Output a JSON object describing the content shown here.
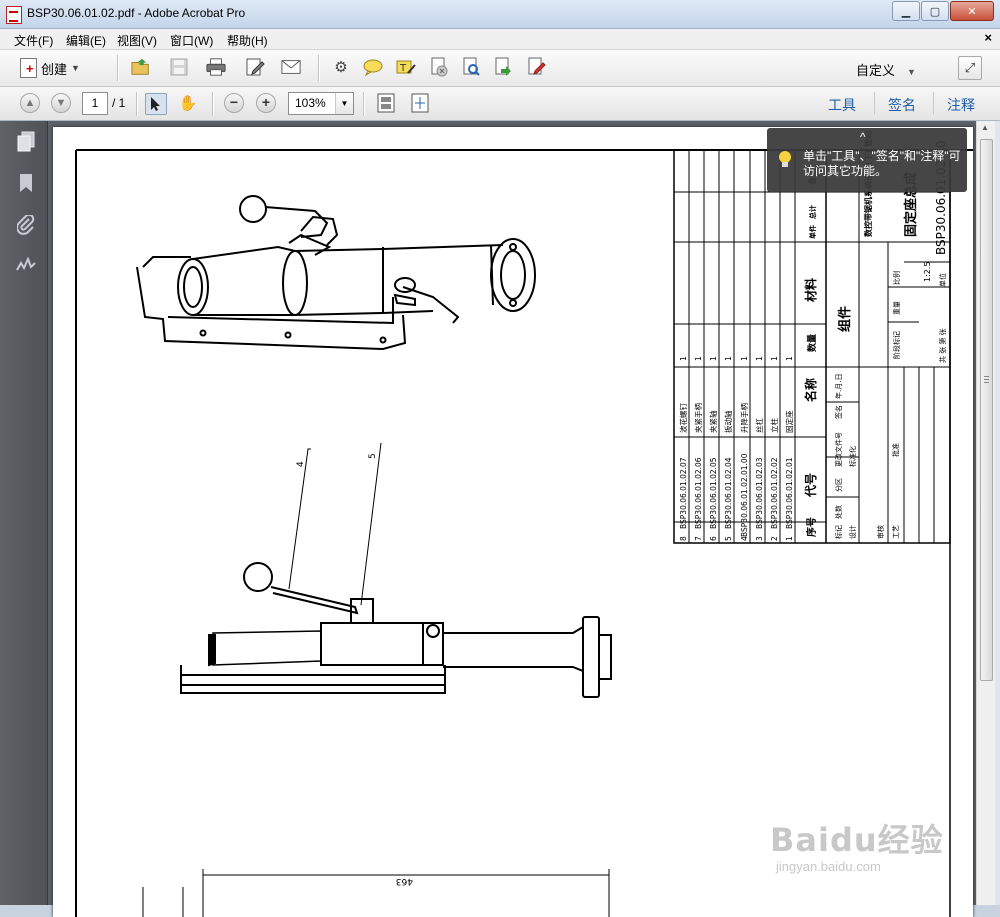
{
  "window": {
    "title": "BSP30.06.01.02.pdf - Adobe Acrobat Pro",
    "min_label": "▁",
    "max_label": "▢",
    "close_label": "✕"
  },
  "menu": {
    "items": [
      "文件(F)",
      "编辑(E)",
      "视图(V)",
      "窗口(W)",
      "帮助(H)"
    ],
    "close": "×"
  },
  "toolbar": {
    "create_label": "创建",
    "customize_label": "自定义",
    "customize_arrow": "▼"
  },
  "nav": {
    "current_page": "1",
    "total_pages": "/ 1",
    "zoom": "103%",
    "links": [
      "工具",
      "签名",
      "注释"
    ]
  },
  "tooltip": {
    "text": "单击\"工具\"、\"签名\"和\"注释\"可访问其它功能。",
    "caret": "^"
  },
  "drawing": {
    "title_block": {
      "part_name": "固定座总成",
      "drawing_number": "BSP30.06.01.02.00",
      "project": "数控带锯机系统设计(下) 管制",
      "category": "组件",
      "material_header": "材料",
      "scale_label": "比例",
      "scale": "1:2.5",
      "weight_label": "重量",
      "sheets_label": "共 张 第 张",
      "stage_label": "阶段标记",
      "company": "单位"
    },
    "parts_header": {
      "index": "序号",
      "code": "代号",
      "name": "名称",
      "qty": "数量",
      "material": "材料",
      "single_weight": "单件",
      "total_weight": "总计",
      "remark": "备注"
    },
    "parts": [
      {
        "index": "8",
        "code": "BSP30.06.01.02.07",
        "name": "波花螺钉",
        "qty": "1"
      },
      {
        "index": "7",
        "code": "BSP30.06.01.02.06",
        "name": "夹紧手柄",
        "qty": "1"
      },
      {
        "index": "6",
        "code": "BSP30.06.01.02.05",
        "name": "夹紧轴",
        "qty": "1"
      },
      {
        "index": "5",
        "code": "BSP30.06.01.02.04",
        "name": "扳动轴",
        "qty": "1"
      },
      {
        "index": "4",
        "code": "BSP30.06.01.02.01.00",
        "name": "升降手柄",
        "qty": "1"
      },
      {
        "index": "3",
        "code": "BSP30.06.01.02.03",
        "name": "丝杠",
        "qty": "1"
      },
      {
        "index": "2",
        "code": "BSP30.06.01.02.02",
        "name": "立柱",
        "qty": "1"
      },
      {
        "index": "1",
        "code": "BSP30.06.01.02.01",
        "name": "固定座",
        "qty": "1"
      }
    ],
    "signoff": {
      "mark": "标记",
      "count": "处数",
      "zone": "分区",
      "change_doc": "更改文件号",
      "sign": "签名",
      "date": "年.月.日",
      "design": "设计",
      "standard": "标准化",
      "review": "审核",
      "process": "工艺",
      "approve": "批准"
    },
    "callouts": [
      "4",
      "5"
    ],
    "dimension": "463"
  },
  "watermark": {
    "brand": "Baidu经验",
    "url": "jingyan.baidu.com"
  }
}
